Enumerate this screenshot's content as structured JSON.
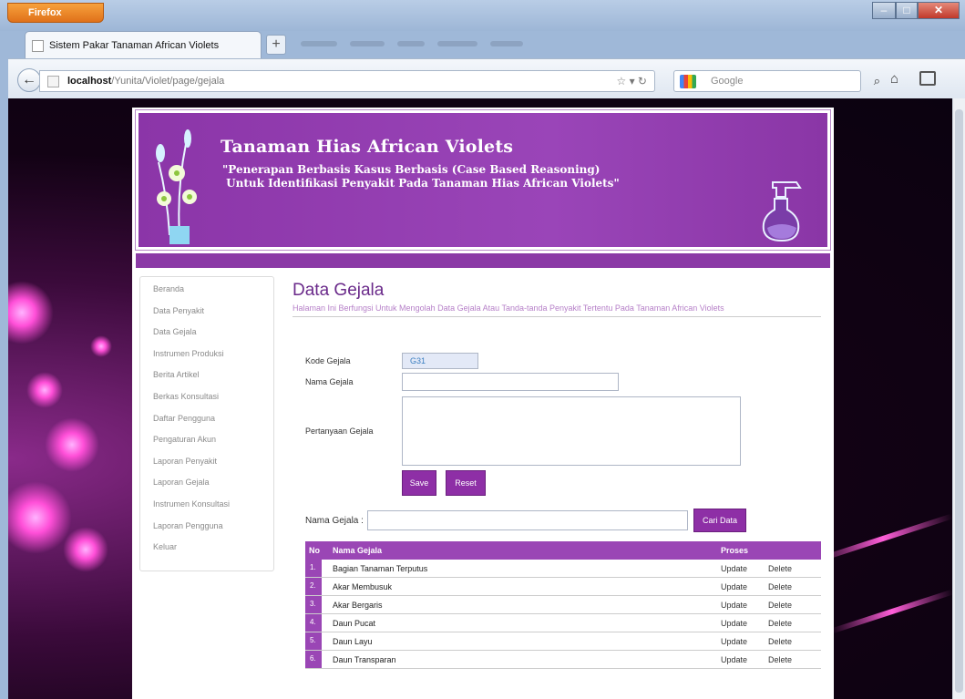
{
  "browser": {
    "menu_label": "Firefox",
    "tab_title": "Sistem Pakar Tanaman African Violets",
    "url_host": "localhost",
    "url_path": "/Yunita/Violet/page/gejala",
    "search_placeholder": "Google"
  },
  "banner": {
    "title": "Tanaman Hias African Violets",
    "subtitle": "\"Penerapan Berbasis Kasus Berbasis (Case Based Reasoning)\n Untuk Identifikasi Penyakit Pada Tanaman Hias African Violets\""
  },
  "sidebar": {
    "items": [
      {
        "label": "Beranda"
      },
      {
        "label": "Data Penyakit"
      },
      {
        "label": "Data Gejala"
      },
      {
        "label": "Instrumen Produksi"
      },
      {
        "label": "Berita Artikel"
      },
      {
        "label": "Berkas Konsultasi"
      },
      {
        "label": "Daftar Pengguna"
      },
      {
        "label": "Pengaturan Akun"
      },
      {
        "label": "Laporan Penyakit"
      },
      {
        "label": "Laporan Gejala"
      },
      {
        "label": "Instrumen Konsultasi"
      },
      {
        "label": "Laporan Pengguna"
      },
      {
        "label": "Keluar"
      }
    ]
  },
  "main": {
    "title": "Data Gejala",
    "description": "Halaman Ini Berfungsi Untuk Mengolah Data Gejala Atau Tanda-tanda Penyakit Tertentu Pada Tanaman African Violets",
    "form": {
      "kode_label": "Kode Gejala",
      "kode_value": "G31",
      "nama_label": "Nama Gejala",
      "nama_value": "",
      "pertanyaan_label": "Pertanyaan Gejala",
      "pertanyaan_value": "",
      "save_label": "Save",
      "reset_label": "Reset"
    },
    "search": {
      "label": "Nama Gejala :",
      "value": "",
      "button_label": "Cari Data"
    },
    "table": {
      "headers": [
        "No",
        "Nama Gejala",
        "Proses"
      ],
      "update_label": "Update",
      "delete_label": "Delete",
      "rows": [
        {
          "no": "1.",
          "nama": "Bagian Tanaman Terputus"
        },
        {
          "no": "2.",
          "nama": "Akar Membusuk"
        },
        {
          "no": "3.",
          "nama": "Akar Bergaris"
        },
        {
          "no": "4.",
          "nama": "Daun Pucat"
        },
        {
          "no": "5.",
          "nama": "Daun Layu"
        },
        {
          "no": "6.",
          "nama": "Daun Transparan"
        }
      ]
    }
  },
  "colors": {
    "accent": "#9a46b5",
    "banner": "#8b35a8"
  }
}
